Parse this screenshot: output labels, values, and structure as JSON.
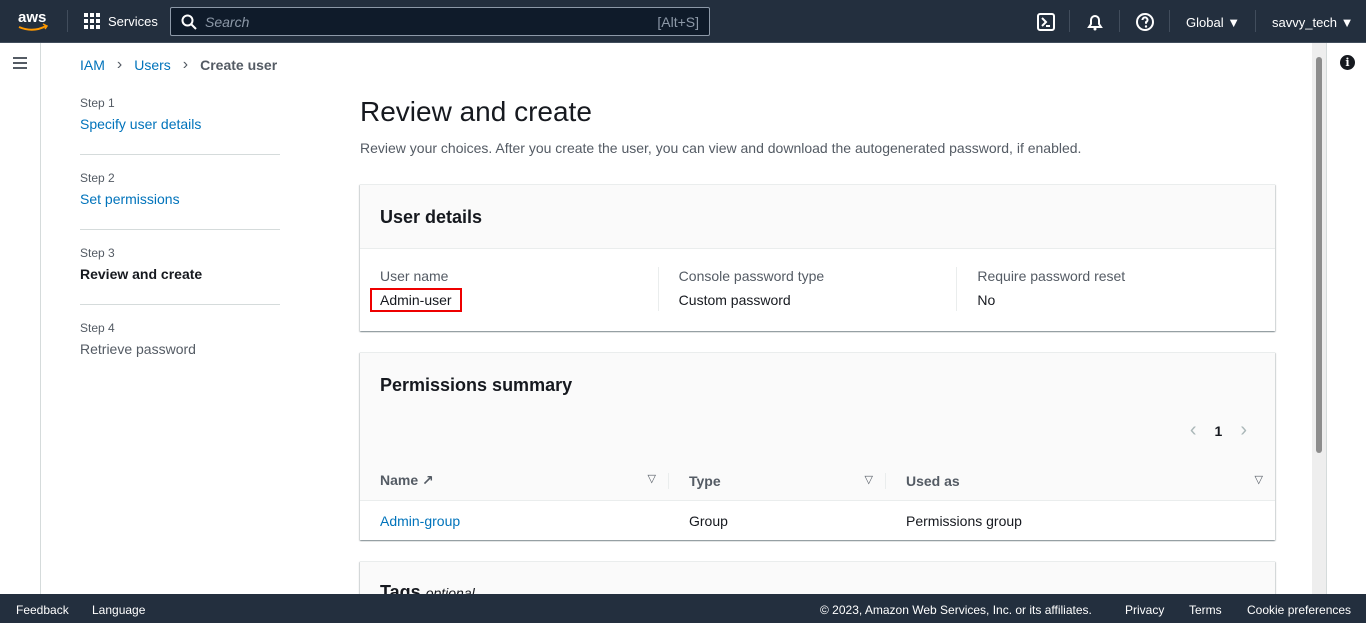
{
  "topnav": {
    "logo": "aws",
    "services": "Services",
    "search_placeholder": "Search",
    "search_shortcut": "[Alt+S]",
    "region": "Global",
    "account": "savvy_tech"
  },
  "breadcrumb": [
    "IAM",
    "Users",
    "Create user"
  ],
  "steps": [
    {
      "step": "Step 1",
      "label": "Specify user details",
      "state": "link"
    },
    {
      "step": "Step 2",
      "label": "Set permissions",
      "state": "link"
    },
    {
      "step": "Step 3",
      "label": "Review and create",
      "state": "active"
    },
    {
      "step": "Step 4",
      "label": "Retrieve password",
      "state": "disabled"
    }
  ],
  "page": {
    "title": "Review and create",
    "description": "Review your choices. After you create the user, you can view and download the autogenerated password, if enabled."
  },
  "user_details": {
    "title": "User details",
    "fields": [
      {
        "label": "User name",
        "value": "Admin-user"
      },
      {
        "label": "Console password type",
        "value": "Custom password"
      },
      {
        "label": "Require password reset",
        "value": "No"
      }
    ]
  },
  "permissions": {
    "title": "Permissions summary",
    "page": "1",
    "columns": [
      "Name",
      "Type",
      "Used as"
    ],
    "rows": [
      {
        "name": "Admin-group",
        "type": "Group",
        "used_as": "Permissions group"
      }
    ]
  },
  "tags": {
    "title": "Tags",
    "optional": "optional"
  },
  "footer": {
    "feedback": "Feedback",
    "language": "Language",
    "copyright": "© 2023, Amazon Web Services, Inc. or its affiliates.",
    "privacy": "Privacy",
    "terms": "Terms",
    "cookies": "Cookie preferences"
  },
  "colors": {
    "nav": "#232f3e",
    "link": "#0073bb",
    "highlight": "#ee0000"
  }
}
